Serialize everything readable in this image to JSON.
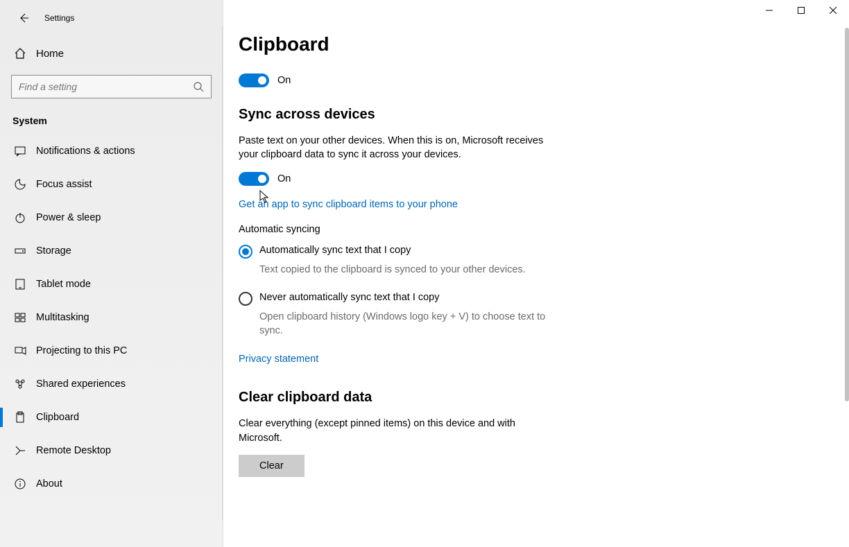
{
  "window": {
    "app_title": "Settings"
  },
  "sidebar": {
    "home_label": "Home",
    "search_placeholder": "Find a setting",
    "category_label": "System",
    "items": [
      {
        "label": "Notifications & actions"
      },
      {
        "label": "Focus assist"
      },
      {
        "label": "Power & sleep"
      },
      {
        "label": "Storage"
      },
      {
        "label": "Tablet mode"
      },
      {
        "label": "Multitasking"
      },
      {
        "label": "Projecting to this PC"
      },
      {
        "label": "Shared experiences"
      },
      {
        "label": "Clipboard"
      },
      {
        "label": "Remote Desktop"
      },
      {
        "label": "About"
      }
    ]
  },
  "main": {
    "page_title": "Clipboard",
    "history_toggle": {
      "state_label": "On"
    },
    "sync": {
      "title": "Sync across devices",
      "description": "Paste text on your other devices. When this is on, Microsoft receives your clipboard data to sync it across your devices.",
      "toggle_state_label": "On",
      "link": "Get an app to sync clipboard items to your phone",
      "auto_heading": "Automatic syncing",
      "radio1_label": "Automatically sync text that I copy",
      "radio1_desc": "Text copied to the clipboard is synced to your other devices.",
      "radio2_label": "Never automatically sync text that I copy",
      "radio2_desc": "Open clipboard history (Windows logo key + V) to choose text to sync.",
      "privacy_link": "Privacy statement"
    },
    "clear": {
      "title": "Clear clipboard data",
      "description": "Clear everything (except pinned items) on this device and with Microsoft.",
      "button_label": "Clear"
    }
  }
}
